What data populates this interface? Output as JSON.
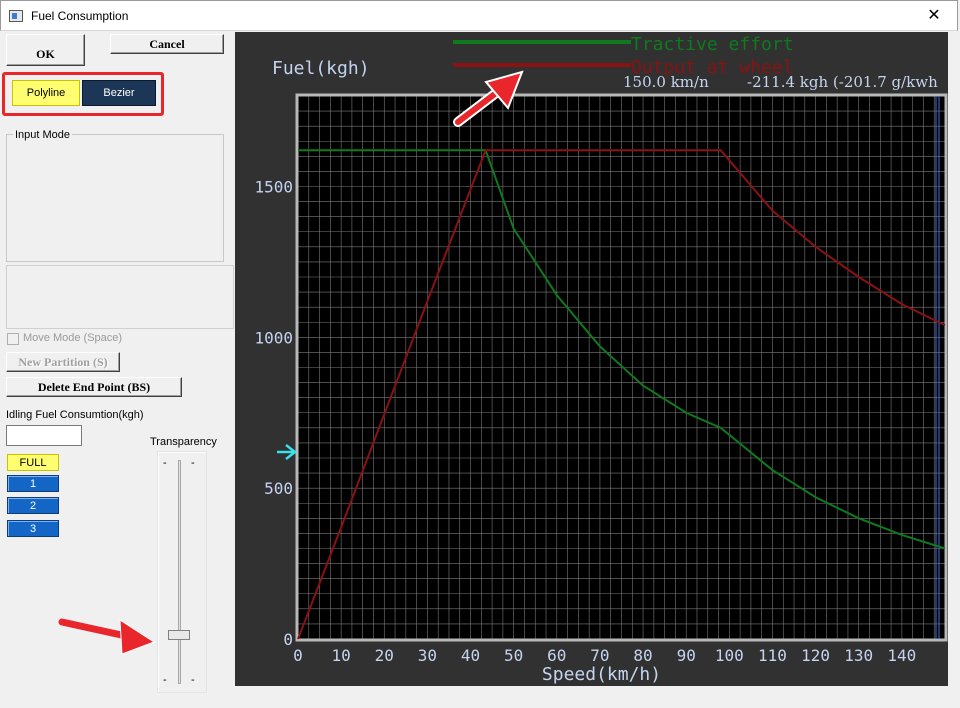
{
  "window": {
    "title": "Fuel Consumption",
    "close_glyph": "✕"
  },
  "buttons": {
    "ok": "OK",
    "cancel": "Cancel",
    "polyline": "Polyline",
    "bezier": "Bezier",
    "new_partition": "New Partition (S)",
    "delete_end_point": "Delete End Point (BS)"
  },
  "input_mode": {
    "label": "Input Mode"
  },
  "move_mode": {
    "label": "Move Mode (Space)",
    "checked": false
  },
  "idling": {
    "label": "Idling Fuel Consumtion(kgh)",
    "value": ""
  },
  "levels": [
    "FULL",
    "1",
    "2",
    "3"
  ],
  "transparency": {
    "label": "Transparency",
    "tick_glyph": "-",
    "value_fraction": 0.12
  },
  "colors": {
    "accent_red": "#e8262b",
    "polyline_bg": "#fffe71",
    "bezier_bg": "#1b3656",
    "tractive": "#0f7a1d",
    "output": "#8a1212",
    "chart_bg": "#313131",
    "plot_bg": "#000000",
    "grid": "#7a7a7a",
    "indicator": "#38e1ee"
  },
  "chart_data": {
    "type": "line",
    "ylabel": "Fuel(kgh)",
    "xlabel": "Speed(km/h)",
    "xlim": [
      0,
      150
    ],
    "ylim": [
      0,
      1800
    ],
    "x_ticks": [
      0,
      10,
      20,
      30,
      40,
      50,
      60,
      70,
      80,
      90,
      100,
      110,
      120,
      130,
      140
    ],
    "y_ticks": [
      0,
      500,
      1000,
      1500
    ],
    "grid": true,
    "legend_position": "top-center",
    "readout": {
      "speed": "150.0 km/n",
      "fuel": "-211.4 kgh (-201.7 g/kwh"
    },
    "marker_y": 620,
    "series": [
      {
        "name": "Tractive effort",
        "color": "#0f7a1d",
        "x": [
          0,
          43.5,
          50,
          60,
          70,
          80,
          90,
          98,
          110,
          120,
          130,
          140,
          150
        ],
        "y": [
          1620,
          1620,
          1360,
          1140,
          970,
          840,
          750,
          700,
          560,
          470,
          400,
          345,
          300
        ]
      },
      {
        "name": "Output at wheel",
        "color": "#8a1212",
        "x": [
          0,
          10,
          20,
          30,
          43.5,
          60,
          80,
          98,
          110,
          120,
          130,
          140,
          150
        ],
        "y": [
          0,
          370,
          745,
          1120,
          1620,
          1620,
          1620,
          1620,
          1420,
          1300,
          1200,
          1110,
          1040
        ]
      }
    ]
  }
}
